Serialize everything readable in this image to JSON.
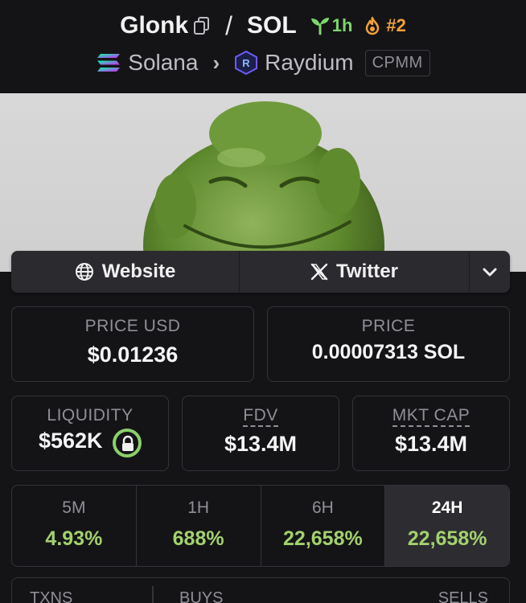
{
  "pair": {
    "base_symbol": "Glonk",
    "separator": "/",
    "quote_symbol": "SOL",
    "age": "1h",
    "rank": "#2"
  },
  "chain": {
    "chain_name": "Solana",
    "dex_name": "Raydium",
    "pool_type": "CPMM"
  },
  "links": {
    "website_label": "Website",
    "twitter_label": "Twitter"
  },
  "stats": {
    "price_usd_label": "PRICE USD",
    "price_usd_value": "$0.01236",
    "price_label": "PRICE",
    "price_value": "0.00007313 SOL",
    "liquidity_label": "LIQUIDITY",
    "liquidity_value": "$562K",
    "fdv_label": "FDV",
    "fdv_value": "$13.4M",
    "mktcap_label": "MKT CAP",
    "mktcap_value": "$13.4M"
  },
  "changes": [
    {
      "label": "5M",
      "value": "4.93%"
    },
    {
      "label": "1H",
      "value": "688%"
    },
    {
      "label": "6H",
      "value": "22,658%"
    },
    {
      "label": "24H",
      "value": "22,658%"
    }
  ],
  "txns": {
    "txns_label": "TXNS",
    "buys_label": "BUYS",
    "sells_label": "SELLS"
  },
  "colors": {
    "background": "#141417",
    "positive": "#a3d16e",
    "age_green": "#7fd66b",
    "rank_orange": "#f2a13a",
    "lock_green": "#8bcf6a"
  },
  "icons": [
    "copy-icon",
    "sprout-icon",
    "flame-icon",
    "solana-icon",
    "chevron-right-icon",
    "raydium-icon",
    "globe-icon",
    "x-icon",
    "chevron-down-icon",
    "lock-icon"
  ]
}
